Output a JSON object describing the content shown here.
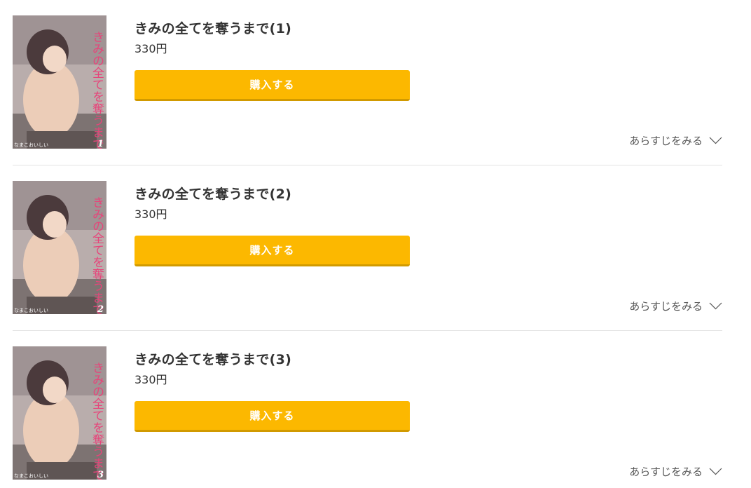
{
  "items": [
    {
      "title": "きみの全てを奪うまで(1)",
      "price": "330円",
      "buy_label": "購入する",
      "synopsis_label": "あらすじをみる",
      "cover": {
        "title_text": "きみの全てを奪うまで",
        "volume": "1",
        "author": "なまこおいしい"
      }
    },
    {
      "title": "きみの全てを奪うまで(2)",
      "price": "330円",
      "buy_label": "購入する",
      "synopsis_label": "あらすじをみる",
      "cover": {
        "title_text": "きみの全てを奪うまで",
        "volume": "2",
        "author": "なまこおいしい"
      }
    },
    {
      "title": "きみの全てを奪うまで(3)",
      "price": "330円",
      "buy_label": "購入する",
      "synopsis_label": "あらすじをみる",
      "cover": {
        "title_text": "きみの全てを奪うまで",
        "volume": "3",
        "author": "なまこおいしい"
      }
    }
  ],
  "colors": {
    "buy_button": "#fcb800",
    "buy_button_shadow": "#d19a00",
    "divider": "#e2e2e2",
    "text": "#333333"
  },
  "icons": {
    "synopsis_toggle": "chevron-down-icon"
  }
}
